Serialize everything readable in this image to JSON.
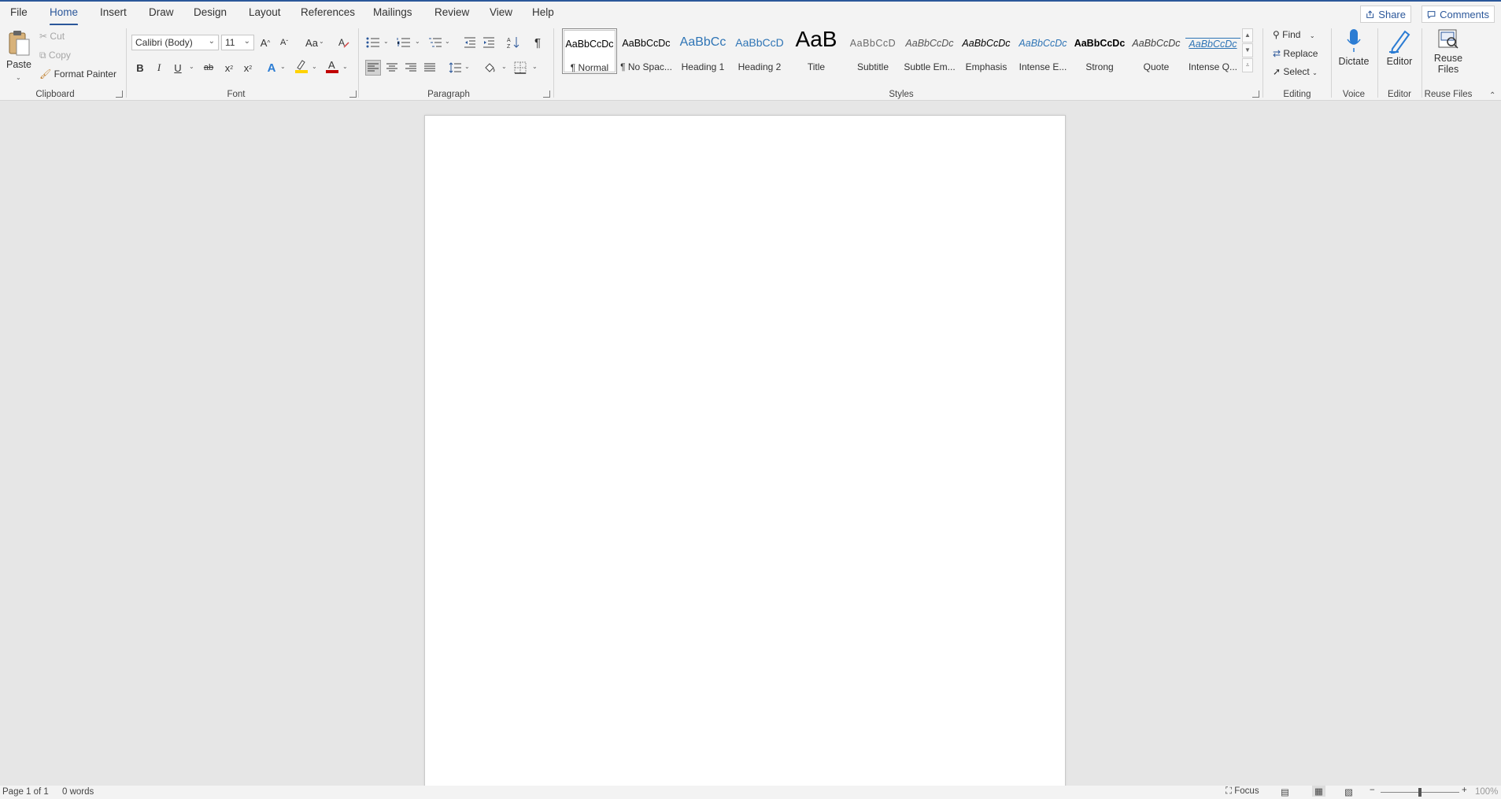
{
  "tabs": [
    "File",
    "Home",
    "Insert",
    "Draw",
    "Design",
    "Layout",
    "References",
    "Mailings",
    "Review",
    "View",
    "Help"
  ],
  "active_tab": "Home",
  "top_right": {
    "share": "Share",
    "comments": "Comments"
  },
  "clipboard": {
    "paste": "Paste",
    "cut": "Cut",
    "copy": "Copy",
    "format_painter": "Format Painter",
    "label": "Clipboard"
  },
  "font": {
    "name": "Calibri (Body)",
    "size": "11",
    "change_case": "Aa",
    "bold": "B",
    "italic": "I",
    "underline": "U",
    "strikethrough": "ab",
    "subscript": "x",
    "superscript": "x",
    "text_effects": "A",
    "font_color": "A",
    "grow": "A",
    "shrink": "A",
    "label": "Font"
  },
  "paragraph": {
    "label": "Paragraph",
    "pilcrow": "¶"
  },
  "styles": {
    "label": "Styles",
    "items": [
      {
        "preview": "AaBbCcDc",
        "name": "¶ Normal"
      },
      {
        "preview": "AaBbCcDc",
        "name": "¶ No Spac..."
      },
      {
        "preview": "AaBbCc",
        "name": "Heading 1"
      },
      {
        "preview": "AaBbCcD",
        "name": "Heading 2"
      },
      {
        "preview": "AaB",
        "name": "Title"
      },
      {
        "preview": "AaBbCcD",
        "name": "Subtitle"
      },
      {
        "preview": "AaBbCcDc",
        "name": "Subtle Em..."
      },
      {
        "preview": "AaBbCcDc",
        "name": "Emphasis"
      },
      {
        "preview": "AaBbCcDc",
        "name": "Intense E..."
      },
      {
        "preview": "AaBbCcDc",
        "name": "Strong"
      },
      {
        "preview": "AaBbCcDc",
        "name": "Quote"
      },
      {
        "preview": "AaBbCcDc",
        "name": "Intense Q..."
      }
    ]
  },
  "editing": {
    "find": "Find",
    "replace": "Replace",
    "select": "Select",
    "label": "Editing"
  },
  "voice": {
    "dictate": "Dictate",
    "label": "Voice"
  },
  "editor": {
    "editor": "Editor",
    "label": "Editor"
  },
  "reuse": {
    "line1": "Reuse",
    "line2": "Files",
    "label": "Reuse Files"
  },
  "status": {
    "page": "Page 1 of 1",
    "words": "0 words",
    "focus": "Focus",
    "zoom": "100%"
  },
  "colors": {
    "accent": "#2b579a",
    "highlight": "#ffd200",
    "font_color": "#c00000",
    "dictate": "#2b7cd3"
  }
}
